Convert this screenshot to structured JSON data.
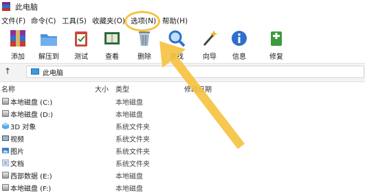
{
  "window": {
    "title": "此电脑"
  },
  "menu": {
    "items": [
      {
        "label": "文件(F)"
      },
      {
        "label": "命令(C)"
      },
      {
        "label": "工具(S)"
      },
      {
        "label": "收藏夹(O)"
      },
      {
        "label": "选项(N)"
      },
      {
        "label": "帮助(H)"
      }
    ]
  },
  "toolbar": {
    "buttons": [
      {
        "label": "添加",
        "icon": "add-archive-icon"
      },
      {
        "label": "解压到",
        "icon": "extract-folder-icon"
      },
      {
        "label": "测试",
        "icon": "test-clipboard-icon"
      },
      {
        "label": "查看",
        "icon": "view-book-icon"
      },
      {
        "label": "删除",
        "icon": "delete-trash-icon"
      },
      {
        "label": "查找",
        "icon": "find-magnifier-icon"
      },
      {
        "label": "向导",
        "icon": "wizard-wand-icon"
      },
      {
        "label": "信息",
        "icon": "info-icon"
      },
      {
        "label": "修复",
        "icon": "repair-kit-icon"
      }
    ]
  },
  "address": {
    "path": "此电脑"
  },
  "columns": {
    "name": "名称",
    "size": "大小",
    "type": "类型",
    "modified": "修改日期"
  },
  "files": [
    {
      "name": "本地磁盘 (C:)",
      "type": "本地磁盘",
      "icon": "drive-icon"
    },
    {
      "name": "本地磁盘 (D:)",
      "type": "本地磁盘",
      "icon": "drive-icon"
    },
    {
      "name": "3D 对象",
      "type": "系统文件夹",
      "icon": "3d-objects-icon"
    },
    {
      "name": "视频",
      "type": "系统文件夹",
      "icon": "video-icon"
    },
    {
      "name": "图片",
      "type": "系统文件夹",
      "icon": "pictures-icon"
    },
    {
      "name": "文档",
      "type": "系统文件夹",
      "icon": "documents-icon"
    },
    {
      "name": "西部数据 (E:)",
      "type": "本地磁盘",
      "icon": "drive-icon"
    },
    {
      "name": "本地磁盘 (F:)",
      "type": "本地磁盘",
      "icon": "drive-icon"
    }
  ],
  "colors": {
    "highlight": "#f6c23e",
    "address_bg": "#f3f3f3"
  }
}
